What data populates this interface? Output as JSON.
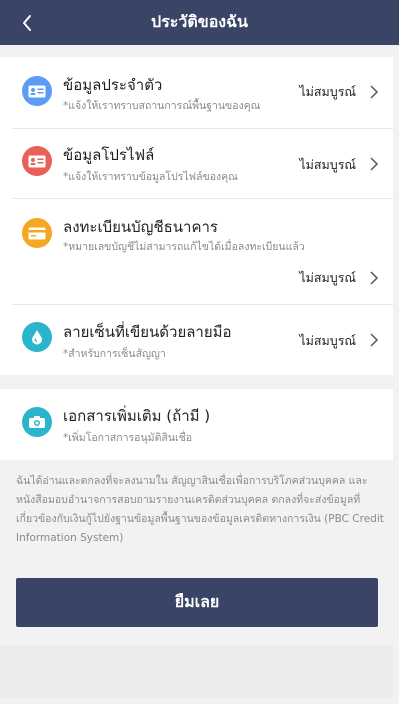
{
  "header": {
    "title": "ประวัติของฉัน",
    "back_icon": "chevron-left-icon"
  },
  "items": [
    {
      "title": "ข้อมูลประจำตัว",
      "subtitle": "*แจ้งให้เราทราบสถานการณ์พื้นฐานของคุณ",
      "status": "ไม่สมบูรณ์",
      "icon": "id-card-icon",
      "icon_color": "#5b9df5"
    },
    {
      "title": "ข้อมูลโปรไฟล์",
      "subtitle": "*แจ้งให้เราทราบข้อมูลโปรไฟล์ของคุณ",
      "status": "ไม่สมบูรณ์",
      "icon": "profile-card-icon",
      "icon_color": "#e8605a"
    },
    {
      "title": "ลงทะเบียนบัญชีธนาคาร",
      "subtitle": "*หมายเลขบัญชีไม่สามารถแก้ไขได้เมื่อลงทะเบียนแล้ว",
      "status": "ไม่สมบูรณ์",
      "icon": "bank-card-icon",
      "icon_color": "#f5a623"
    },
    {
      "title": "ลายเซ็นที่เขียนด้วยลายมือ",
      "subtitle": "*สำหรับการเซ็นสัญญา",
      "status": "ไม่สมบูรณ์",
      "icon": "signature-drop-icon",
      "icon_color": "#2bb5cc"
    }
  ],
  "extra": {
    "title": "เอกสารเพิ่มเติม (ถ้ามี )",
    "subtitle": "*เพิ่มโอกาสการอนุมัติสินเชื่อ",
    "icon": "camera-icon",
    "icon_color": "#2bb5cc"
  },
  "consent_text": "ฉันได้อ่านและตกลงที่จะลงนามใน สัญญาสินเชื่อเพื่อการบริโภคส่วนบุคคล และ หนังสือมอบอำนาจการสอบถามรายงานเครดิตส่วนบุคคล ตกลงที่จะส่งข้อมูลที่เกี่ยวข้องกับเงินกู้ไปยังฐานข้อมูลพื้นฐานของข้อมูลเครดิตทางการเงิน (PBC Credit Information System)",
  "submit_label": "ยืมเลย",
  "colors": {
    "header_bg": "#3a4466",
    "button_bg": "#3a4466",
    "page_bg": "#f2f2f5"
  }
}
